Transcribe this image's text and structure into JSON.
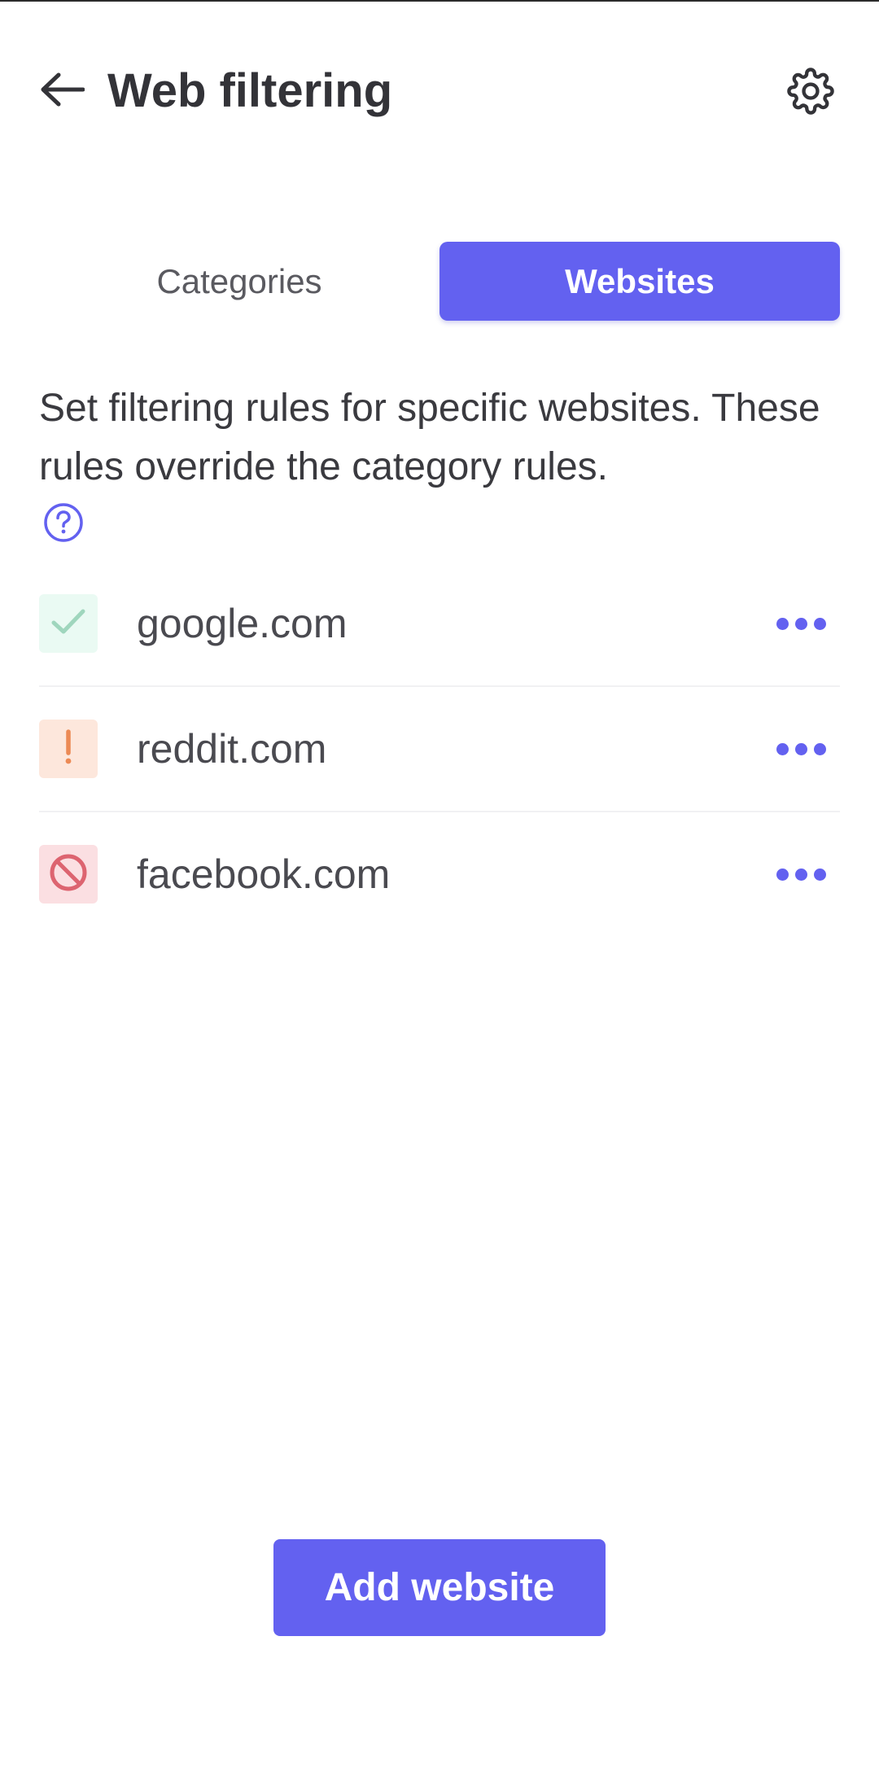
{
  "header": {
    "title": "Web filtering",
    "back_icon": "arrow-left-icon",
    "settings_icon": "gear-icon"
  },
  "tabs": [
    {
      "label": "Categories",
      "active": false
    },
    {
      "label": "Websites",
      "active": true
    }
  ],
  "description": {
    "text": "Set filtering rules for specific websites. These rules override the category rules.",
    "help_icon": "question-circle-icon"
  },
  "websites": [
    {
      "domain": "google.com",
      "status": "allowed",
      "status_icon": "check-icon",
      "more_icon": "more-dots-icon"
    },
    {
      "domain": "reddit.com",
      "status": "warning",
      "status_icon": "exclamation-icon",
      "more_icon": "more-dots-icon"
    },
    {
      "domain": "facebook.com",
      "status": "blocked",
      "status_icon": "blocked-icon",
      "more_icon": "more-dots-icon"
    }
  ],
  "actions": {
    "add_website_label": "Add website"
  },
  "colors": {
    "accent": "#6361f0",
    "allowed_bg": "#eafaf3",
    "allowed_fg": "#9fd6bd",
    "warning_bg": "#fde7dc",
    "warning_fg": "#ec8a55",
    "blocked_bg": "#fbdfe2",
    "blocked_fg": "#dd6470"
  }
}
